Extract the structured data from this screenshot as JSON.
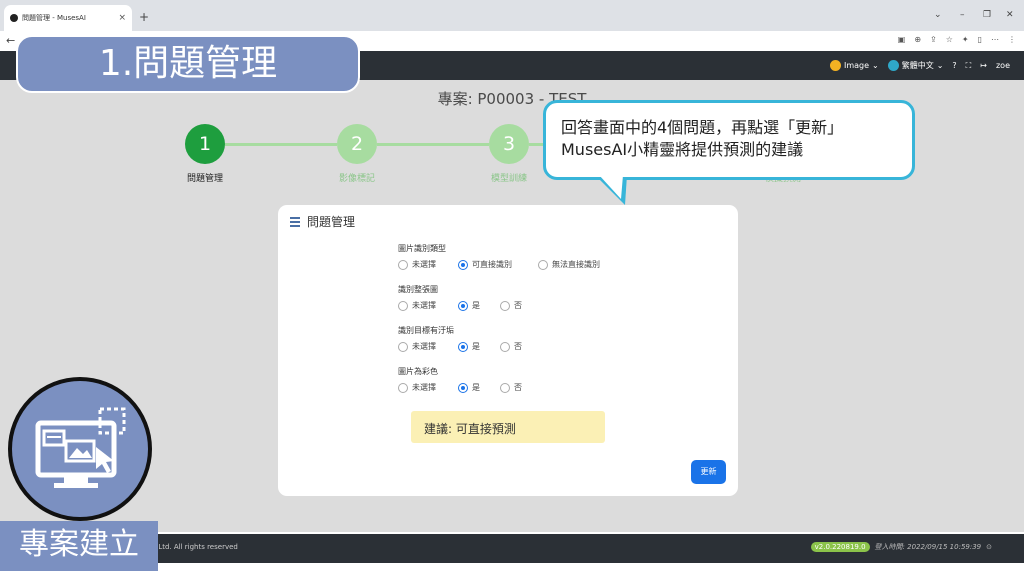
{
  "browser": {
    "tab_title": "問題管理 - MusesAI",
    "tab_close": "×",
    "new_tab": "+",
    "window_controls": [
      "⌄",
      "–",
      "❐",
      "✕"
    ],
    "back": "←",
    "address_icons": [
      "▣",
      "⊕",
      "⇪",
      "☆",
      "✦",
      "▯",
      "⋯",
      "⋮"
    ]
  },
  "topbar": {
    "image_menu": "Image",
    "lang_menu": "繁體中文",
    "help": "?",
    "expand": "⛶",
    "logout": "↦",
    "user": "zoe"
  },
  "project_title": "專案: P00003 - TEST",
  "steps": [
    {
      "num": "1",
      "label": "問題管理",
      "color": "#1e9e3e",
      "label_color": "#222"
    },
    {
      "num": "2",
      "label": "影像標記",
      "color": "#a7dca0",
      "label_color": "#8bc68a"
    },
    {
      "num": "3",
      "label": "模型訓練",
      "color": "#a7dca0",
      "label_color": "#8bc68a"
    },
    {
      "num": "",
      "label": "模擬預測",
      "color": "#a7dca0",
      "label_color": "#8bc68a"
    }
  ],
  "card": {
    "title": "問題管理",
    "questions": [
      {
        "label": "圖片識別類型",
        "options": [
          "未選擇",
          "可直接識別",
          "無法直接識別"
        ],
        "selected": 1
      },
      {
        "label": "識別整張圖",
        "options": [
          "未選擇",
          "是",
          "否"
        ],
        "selected": 1
      },
      {
        "label": "識別目標有汙垢",
        "options": [
          "未選擇",
          "是",
          "否"
        ],
        "selected": 1
      },
      {
        "label": "圖片為彩色",
        "options": [
          "未選擇",
          "是",
          "否"
        ],
        "selected": 1
      }
    ],
    "suggestion": "建議: 可直接預測",
    "update_button": "更新"
  },
  "footer": {
    "copyright": "s., Ltd. All rights reserved",
    "version": "v2.0.220819.0",
    "login_time": "登入時間: 2022/09/15 10:59:39",
    "clock_icon": "⊙"
  },
  "overlay": {
    "banner": "1.問題管理",
    "bubble_line1": "回答畫面中的4個問題，再點選「更新」",
    "bubble_line2": "MusesAI小精靈將提供預測的建議",
    "section_label": "專案建立",
    "accent_color": "#7b90c1",
    "bubble_border": "#38b5d9"
  }
}
